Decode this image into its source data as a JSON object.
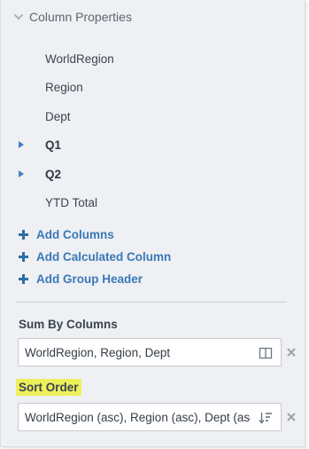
{
  "header": {
    "title": "Column Properties",
    "icon": "chevron-down-icon"
  },
  "columns": [
    {
      "label": "WorldRegion",
      "expandable": false
    },
    {
      "label": "Region",
      "expandable": false
    },
    {
      "label": "Dept",
      "expandable": false
    },
    {
      "label": "Q1",
      "expandable": true
    },
    {
      "label": "Q2",
      "expandable": true
    },
    {
      "label": "YTD Total",
      "expandable": false
    }
  ],
  "actions": {
    "add_columns": "Add Columns",
    "add_calculated_column": "Add Calculated Column",
    "add_group_header": "Add Group Header"
  },
  "sum_by": {
    "label": "Sum By Columns",
    "value": "WorldRegion, Region, Dept",
    "icon": "columns-icon"
  },
  "sort_order": {
    "label": "Sort Order",
    "value": "WorldRegion (asc), Region (asc), Dept (asc)",
    "icon": "sort-icon",
    "highlight_color": "#eef05a"
  },
  "colors": {
    "accent": "#3a78b8",
    "panel_bg": "#eef0f3"
  }
}
